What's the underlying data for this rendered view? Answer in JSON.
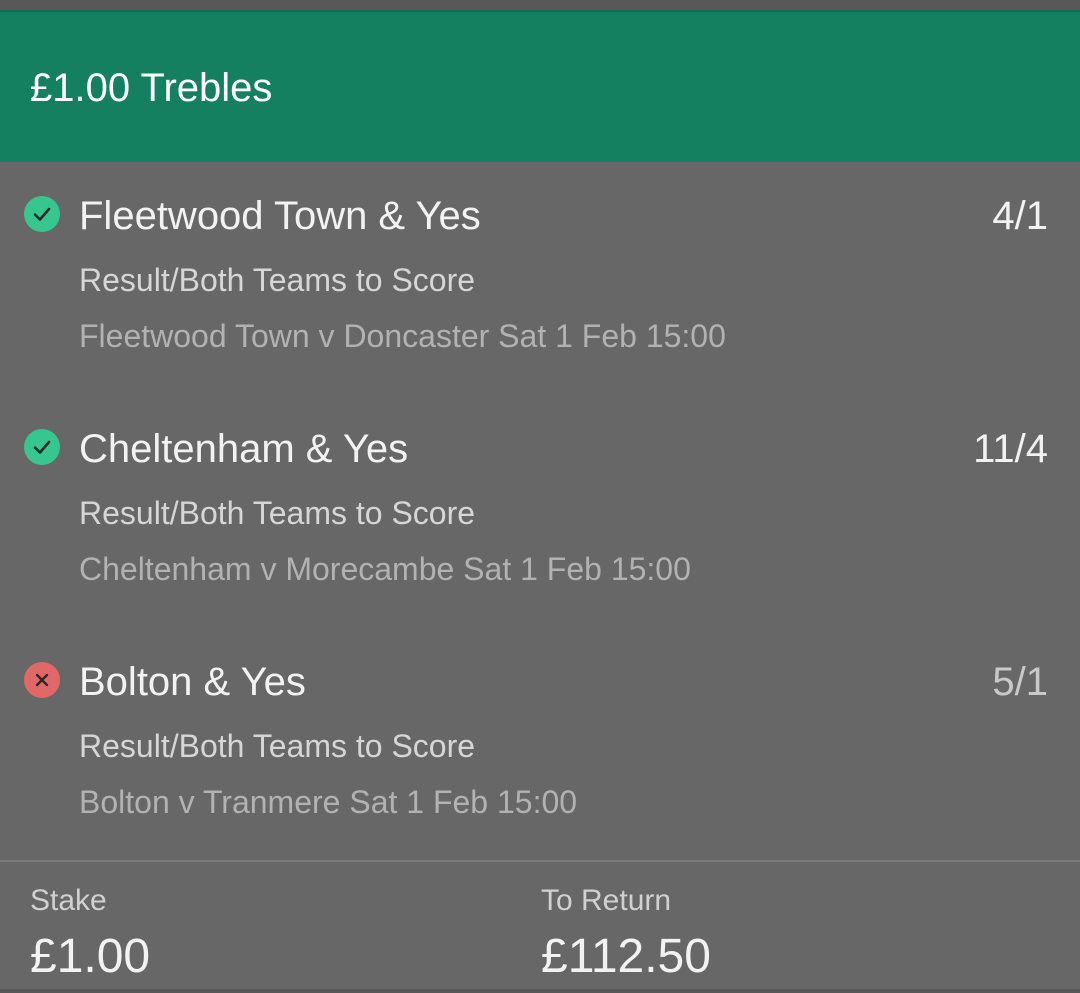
{
  "header": {
    "title": "£1.00 Trebles"
  },
  "selections": [
    {
      "status": "won",
      "status_icon": "check-icon",
      "name": "Fleetwood Town & Yes",
      "odds": "4/1",
      "market": "Result/Both Teams to Score",
      "event": "Fleetwood Town v Doncaster Sat 1 Feb 15:00"
    },
    {
      "status": "won",
      "status_icon": "check-icon",
      "name": "Cheltenham & Yes",
      "odds": "11/4",
      "market": "Result/Both Teams to Score",
      "event": "Cheltenham v Morecambe Sat 1 Feb 15:00"
    },
    {
      "status": "lost",
      "status_icon": "cross-icon",
      "name": "Bolton & Yes",
      "odds": "5/1",
      "market": "Result/Both Teams to Score",
      "event": "Bolton v Tranmere Sat 1 Feb 15:00"
    }
  ],
  "footer": {
    "stake_label": "Stake",
    "stake_value": "£1.00",
    "return_label": "To Return",
    "return_value": "£112.50"
  },
  "colors": {
    "header_bg": "#148060",
    "body_bg": "#676767",
    "won": "#35c78f",
    "lost": "#e26767"
  }
}
